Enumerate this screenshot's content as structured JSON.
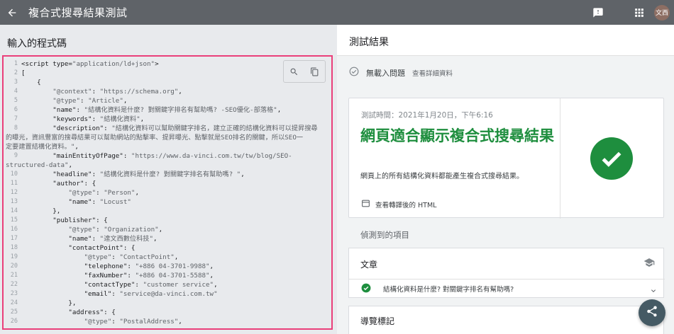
{
  "appbar": {
    "title": "複合式搜尋結果測試",
    "avatar_text": "文西",
    "icons": [
      "arrow-back-icon",
      "feedback-icon",
      "apps-grid-icon"
    ]
  },
  "left": {
    "title": "輸入的程式碼",
    "code_lines": [
      {
        "n": "1",
        "parts": [
          {
            "c": "t",
            "v": "<script type="
          },
          {
            "c": "s",
            "v": "\"application/ld+json\""
          },
          {
            "c": "t",
            "v": ">"
          }
        ]
      },
      {
        "n": "2",
        "parts": [
          {
            "c": "t",
            "v": "["
          }
        ]
      },
      {
        "n": "3",
        "parts": [
          {
            "c": "t",
            "v": "    {"
          }
        ]
      },
      {
        "n": "4",
        "parts": [
          {
            "c": "s",
            "v": "        \"@context\""
          },
          {
            "c": "t",
            "v": ": "
          },
          {
            "c": "s",
            "v": "\"https://schema.org\""
          },
          {
            "c": "t",
            "v": ","
          }
        ]
      },
      {
        "n": "5",
        "parts": [
          {
            "c": "s",
            "v": "        \"@type\""
          },
          {
            "c": "t",
            "v": ": "
          },
          {
            "c": "s",
            "v": "\"Article\""
          },
          {
            "c": "t",
            "v": ","
          }
        ]
      },
      {
        "n": "6",
        "parts": [
          {
            "c": "k",
            "v": "        \"name\""
          },
          {
            "c": "t",
            "v": ": "
          },
          {
            "c": "s",
            "v": "\"結構化資料是什麼? 對關鍵字排名有幫助嗎? -SEO優化-部落格\""
          },
          {
            "c": "t",
            "v": ","
          }
        ]
      },
      {
        "n": "7",
        "parts": [
          {
            "c": "k",
            "v": "        \"keywords\""
          },
          {
            "c": "t",
            "v": ": "
          },
          {
            "c": "s",
            "v": "\"結構化資料\""
          },
          {
            "c": "t",
            "v": ","
          }
        ]
      },
      {
        "n": "8",
        "parts": [
          {
            "c": "k",
            "v": "        \"description\""
          },
          {
            "c": "t",
            "v": ": "
          },
          {
            "c": "s",
            "v": "\"結構化資料可以幫助關鍵字排名，建立正確的結構化資料可以提昇搜尋"
          }
        ]
      },
      {
        "n": "",
        "parts": [
          {
            "c": "s",
            "v": "的曝光，資訊豐富的搜尋結果可以幫助網站的點擊率、提昇曝光、點擊就是SEO排名的關鍵，所以SEO一"
          }
        ],
        "wrap": true
      },
      {
        "n": "",
        "parts": [
          {
            "c": "s",
            "v": "定要建置結構化資料。\""
          },
          {
            "c": "t",
            "v": ","
          }
        ],
        "wrap": true
      },
      {
        "n": "9",
        "parts": [
          {
            "c": "k",
            "v": "        \"mainEntityOfPage\""
          },
          {
            "c": "t",
            "v": ": "
          },
          {
            "c": "s",
            "v": "\"https://www.da-vinci.com.tw/tw/blog/SEO-"
          }
        ]
      },
      {
        "n": "",
        "parts": [
          {
            "c": "s",
            "v": "structured-data\""
          },
          {
            "c": "t",
            "v": ","
          }
        ],
        "wrap": true
      },
      {
        "n": "10",
        "parts": [
          {
            "c": "k",
            "v": "        \"headline\""
          },
          {
            "c": "t",
            "v": ": "
          },
          {
            "c": "s",
            "v": "\"結構化資料是什麼? 對關鍵字排名有幫助嗎? \""
          },
          {
            "c": "t",
            "v": ","
          }
        ]
      },
      {
        "n": "11",
        "parts": [
          {
            "c": "k",
            "v": "        \"author\""
          },
          {
            "c": "t",
            "v": ": {"
          }
        ]
      },
      {
        "n": "12",
        "parts": [
          {
            "c": "s",
            "v": "            \"@type\""
          },
          {
            "c": "t",
            "v": ": "
          },
          {
            "c": "s",
            "v": "\"Person\""
          },
          {
            "c": "t",
            "v": ","
          }
        ]
      },
      {
        "n": "13",
        "parts": [
          {
            "c": "k",
            "v": "            \"name\""
          },
          {
            "c": "t",
            "v": ": "
          },
          {
            "c": "s",
            "v": "\"Locust\""
          }
        ]
      },
      {
        "n": "14",
        "parts": [
          {
            "c": "t",
            "v": "        },"
          }
        ]
      },
      {
        "n": "15",
        "parts": [
          {
            "c": "k",
            "v": "        \"publisher\""
          },
          {
            "c": "t",
            "v": ": {"
          }
        ]
      },
      {
        "n": "16",
        "parts": [
          {
            "c": "s",
            "v": "            \"@type\""
          },
          {
            "c": "t",
            "v": ": "
          },
          {
            "c": "s",
            "v": "\"Organization\""
          },
          {
            "c": "t",
            "v": ","
          }
        ]
      },
      {
        "n": "17",
        "parts": [
          {
            "c": "k",
            "v": "            \"name\""
          },
          {
            "c": "t",
            "v": ": "
          },
          {
            "c": "s",
            "v": "\"達文西數位科技\""
          },
          {
            "c": "t",
            "v": ","
          }
        ]
      },
      {
        "n": "18",
        "parts": [
          {
            "c": "k",
            "v": "            \"contactPoint\""
          },
          {
            "c": "t",
            "v": ": {"
          }
        ]
      },
      {
        "n": "19",
        "parts": [
          {
            "c": "s",
            "v": "                \"@type\""
          },
          {
            "c": "t",
            "v": ": "
          },
          {
            "c": "s",
            "v": "\"ContactPoint\""
          },
          {
            "c": "t",
            "v": ","
          }
        ]
      },
      {
        "n": "20",
        "parts": [
          {
            "c": "k",
            "v": "                \"telephone\""
          },
          {
            "c": "t",
            "v": ": "
          },
          {
            "c": "s",
            "v": "\"+886 04-3701-9988\""
          },
          {
            "c": "t",
            "v": ","
          }
        ]
      },
      {
        "n": "21",
        "parts": [
          {
            "c": "k",
            "v": "                \"faxNumber\""
          },
          {
            "c": "t",
            "v": ": "
          },
          {
            "c": "s",
            "v": "\"+886 04-3701-5588\""
          },
          {
            "c": "t",
            "v": ","
          }
        ]
      },
      {
        "n": "22",
        "parts": [
          {
            "c": "k",
            "v": "                \"contactType\""
          },
          {
            "c": "t",
            "v": ": "
          },
          {
            "c": "s",
            "v": "\"customer service\""
          },
          {
            "c": "t",
            "v": ","
          }
        ]
      },
      {
        "n": "23",
        "parts": [
          {
            "c": "k",
            "v": "                \"email\""
          },
          {
            "c": "t",
            "v": ": "
          },
          {
            "c": "s",
            "v": "\"service@da-vinci.com.tw\""
          }
        ]
      },
      {
        "n": "24",
        "parts": [
          {
            "c": "t",
            "v": "            },"
          }
        ]
      },
      {
        "n": "25",
        "parts": [
          {
            "c": "k",
            "v": "            \"address\""
          },
          {
            "c": "t",
            "v": ": {"
          }
        ]
      },
      {
        "n": "26",
        "parts": [
          {
            "c": "s",
            "v": "                \"@type\""
          },
          {
            "c": "t",
            "v": ": "
          },
          {
            "c": "s",
            "v": "\"PostalAddress\""
          },
          {
            "c": "t",
            "v": ","
          }
        ]
      }
    ]
  },
  "right": {
    "header": "測試結果",
    "status_label": "無載入問題",
    "status_link": "查看詳細資料",
    "test_time": "測試時間：2021年1月20日，下午6:16",
    "big_title": "網頁適合顯示複合式搜尋結果",
    "desc": "網頁上的所有結構化資料都能產生複合式搜尋結果。",
    "view_html": "查看轉譯後的 HTML",
    "detected_label": "偵測到的項目",
    "item1": {
      "head": "文章",
      "row_text": "結構化資料是什麼? 對關鍵字排名有幫助嗎?"
    },
    "item2": {
      "head": "導覽標記"
    }
  },
  "colors": {
    "appbar": "#5f6368",
    "success_green": "#1e8e3e",
    "highlight_border": "#ea3f7a",
    "fab": "#455a64"
  }
}
